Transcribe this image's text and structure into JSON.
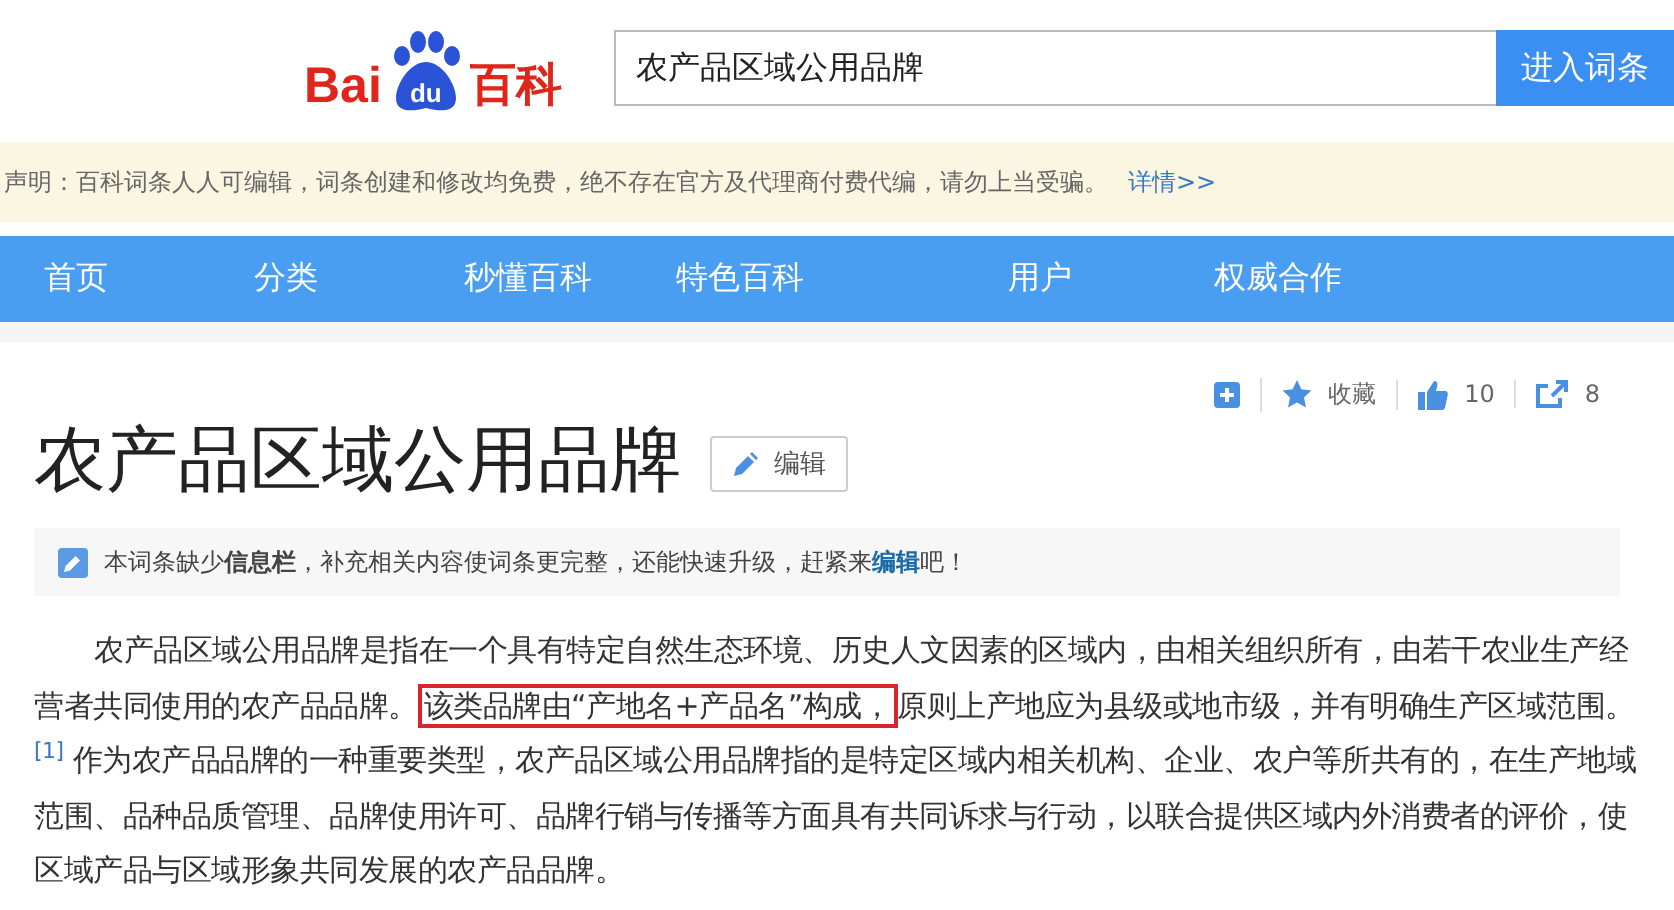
{
  "logo": {
    "text_left": "Bai",
    "badge": "du",
    "text_right": "百科"
  },
  "search": {
    "value": "农产品区域公用品牌",
    "button": "进入词条"
  },
  "notice": {
    "text": "声明：百科词条人人可编辑，词条创建和修改均免费，绝不存在官方及代理商付费代编，请勿上当受骗。",
    "link": "详情>>"
  },
  "nav": [
    {
      "label": "首页"
    },
    {
      "label": "分类"
    },
    {
      "label": "秒懂百科"
    },
    {
      "label": "特色百科"
    },
    {
      "label": "用户"
    },
    {
      "label": "权威合作"
    }
  ],
  "actions": [
    {
      "kind": "add"
    },
    {
      "kind": "star",
      "label": "收藏"
    },
    {
      "kind": "like",
      "label": "10"
    },
    {
      "kind": "share",
      "label": "8"
    }
  ],
  "title": "农产品区域公用品牌",
  "edit_button": "编辑",
  "tip": "本词条缺少**信息栏**，补充相关内容使词条更完整，还能快速升级，赶紧来",
  "tip_link": "编辑",
  "tip_end": "吧！",
  "paragraph": [
    {
      "kind": "text",
      "text": "农产品区域公用品牌是指在一个具有特定自然生态环境、历史人文因素的区域内，由相关组织所有，由若干农业生产经营者共同使用的农产品品牌。"
    },
    {
      "kind": "boxed",
      "text": "该类品牌由“产地名+产品名”构成，"
    },
    {
      "kind": "text",
      "text": "原则上产地应为县级或地市级，并有明确生产区域范围。"
    },
    {
      "kind": "cite",
      "text": "[1]"
    },
    {
      "kind": "text",
      "text": " 作为农产品品牌的一种重要类型，农产品区域公用品牌指的是特定区域内相关机构、企业、农户等所共有的，在生产地域范围、品种品质管理、品牌使用许可、品牌行销与传播等方面具有共同诉求与行动，以联合提供区域内外消费者的评价，使区域产品与区域形象共同发展的农产品品牌。"
    }
  ]
}
